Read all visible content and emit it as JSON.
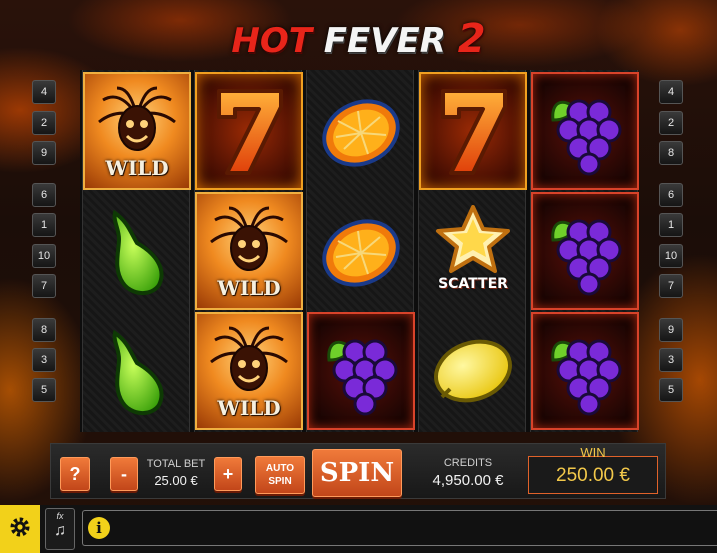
{
  "game": {
    "title_part1": "HOT",
    "title_part2": "FEVER",
    "title_part3": "2"
  },
  "paylines": {
    "left": [
      "4",
      "2",
      "9",
      "6",
      "1",
      "10",
      "7",
      "8",
      "3",
      "5"
    ],
    "right": [
      "4",
      "2",
      "8",
      "6",
      "1",
      "10",
      "7",
      "9",
      "3",
      "5"
    ]
  },
  "reels": [
    [
      {
        "symbol": "wild",
        "label": "WILD"
      },
      {
        "symbol": "pear",
        "label": ""
      },
      {
        "symbol": "pear",
        "label": ""
      }
    ],
    [
      {
        "symbol": "seven",
        "label": ""
      },
      {
        "symbol": "wild",
        "label": "WILD"
      },
      {
        "symbol": "wild",
        "label": "WILD"
      }
    ],
    [
      {
        "symbol": "orange",
        "label": ""
      },
      {
        "symbol": "orange",
        "label": ""
      },
      {
        "symbol": "grapes",
        "label": ""
      }
    ],
    [
      {
        "symbol": "seven",
        "label": ""
      },
      {
        "symbol": "scatter",
        "label": "SCATTER"
      },
      {
        "symbol": "lemon",
        "label": ""
      }
    ],
    [
      {
        "symbol": "grapes",
        "label": ""
      },
      {
        "symbol": "grapes",
        "label": ""
      },
      {
        "symbol": "grapes",
        "label": ""
      }
    ]
  ],
  "controls": {
    "help_label": "?",
    "minus_label": "-",
    "plus_label": "+",
    "total_bet_label": "TOTAL BET",
    "total_bet_value": "25.00 €",
    "autospin_line1": "AUTO",
    "autospin_line2": "SPIN",
    "spin_label": "SPIN",
    "credits_label": "CREDITS",
    "credits_value": "4,950.00 €",
    "win_label": "WIN",
    "win_value": "250.00 €"
  },
  "bottom": {
    "info_symbol": "i",
    "fx_label": "fx"
  },
  "colors": {
    "accent_orange": "#e0622a",
    "win_gold": "#f2c84a",
    "settings_yellow": "#f2d11a"
  }
}
